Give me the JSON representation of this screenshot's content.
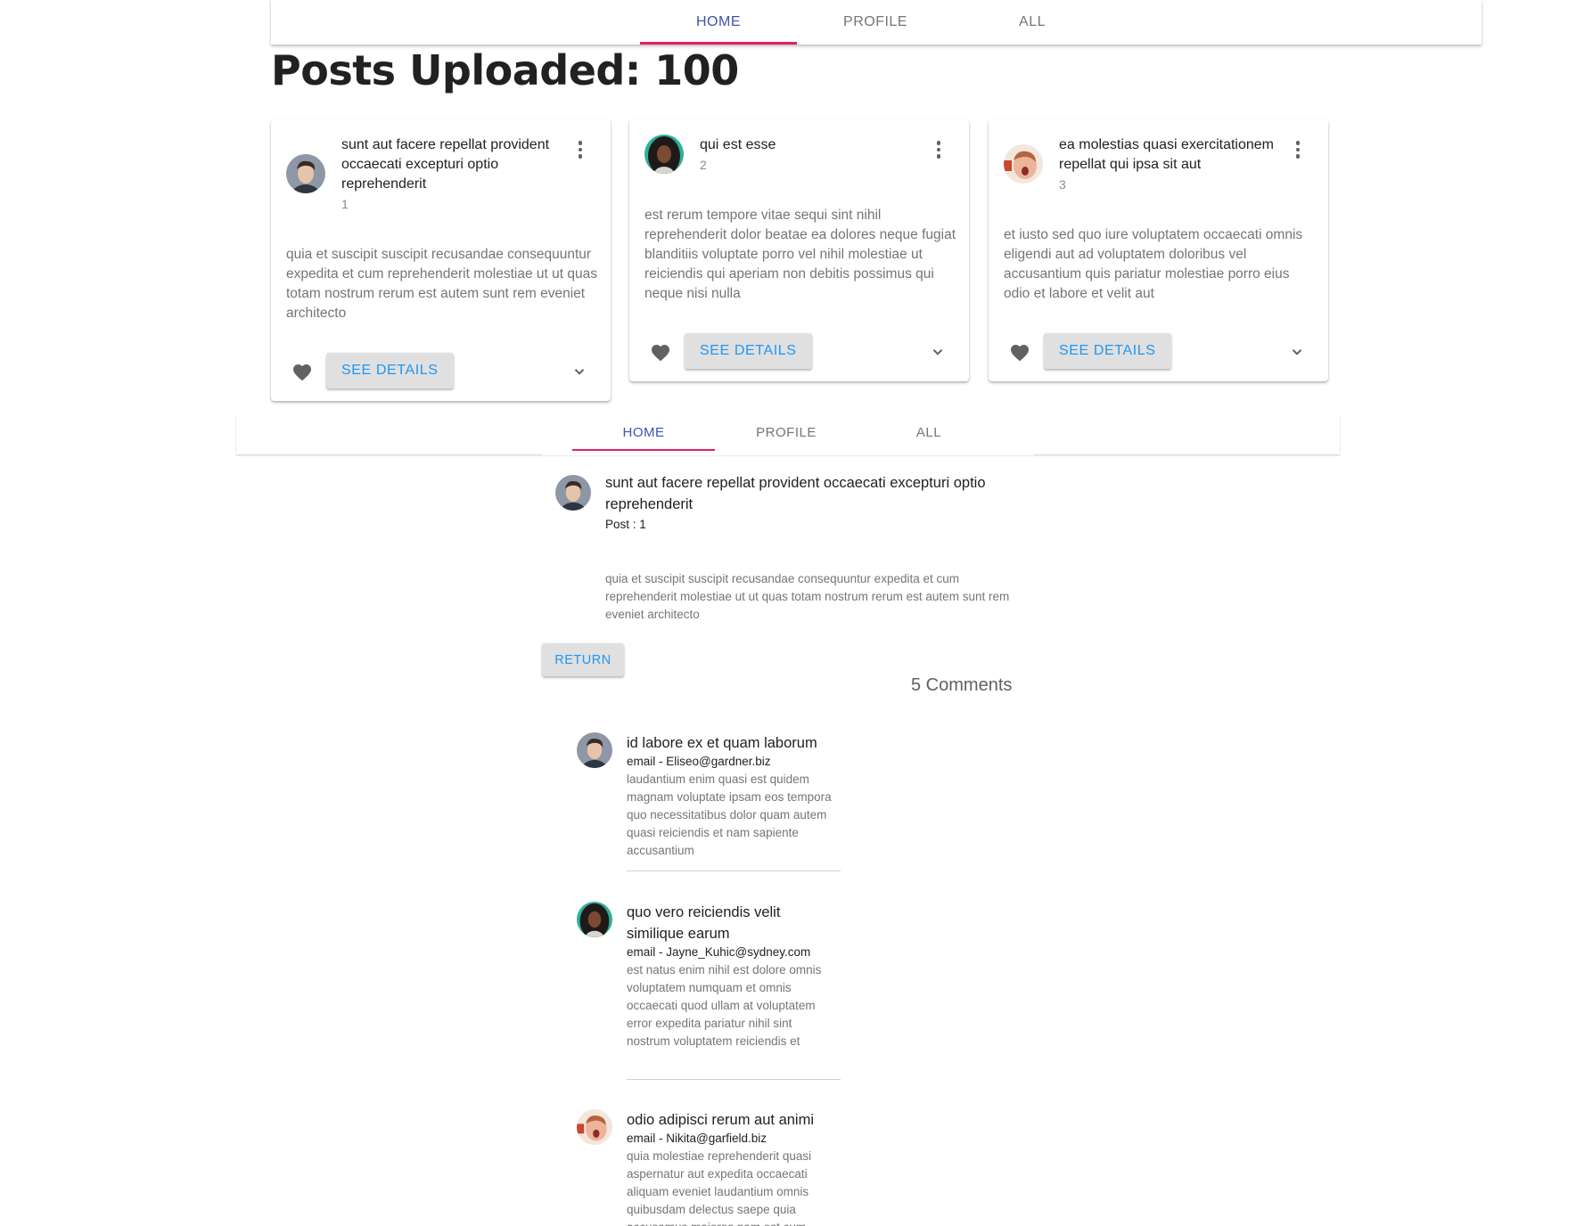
{
  "topnav": {
    "tabs": [
      "HOME",
      "PROFILE",
      "ALL"
    ],
    "active": "HOME"
  },
  "page_title": "Posts Uploaded: 100",
  "cards": [
    {
      "title": "sunt aut facere repellat provident occaecati excepturi optio reprehenderit",
      "id": "1",
      "body": "quia et suscipit suscipit recusandae consequuntur expedita et cum reprehenderit molestiae ut ut quas totam nostrum rerum est autem sunt rem eveniet architecto",
      "button": "SEE DETAILS"
    },
    {
      "title": "qui est esse",
      "id": "2",
      "body": "est rerum tempore vitae sequi sint nihil reprehenderit dolor beatae ea dolores neque fugiat blanditiis voluptate porro vel nihil molestiae ut reiciendis qui aperiam non debitis possimus qui neque nisi nulla",
      "button": "SEE DETAILS"
    },
    {
      "title": "ea molestias quasi exercitationem repellat qui ipsa sit aut",
      "id": "3",
      "body": "et iusto sed quo iure voluptatem occaecati omnis eligendi aut ad voluptatem doloribus vel accusantium quis pariatur molestiae porro eius odio et labore et velit aut",
      "button": "SEE DETAILS"
    }
  ],
  "subnav": {
    "tabs": [
      "HOME",
      "PROFILE",
      "ALL"
    ],
    "active": "HOME"
  },
  "detail": {
    "title": "sunt aut facere repellat provident occaecati excepturi optio reprehenderit",
    "subtitle": "Post : 1",
    "body": "quia et suscipit suscipit recusandae consequuntur expedita et cum reprehenderit molestiae ut ut quas totam nostrum rerum est autem sunt rem eveniet architecto",
    "return_label": "RETURN",
    "comments_count": "5 Comments"
  },
  "comments": [
    {
      "name": "id labore ex et quam laborum",
      "email": "email - Eliseo@gardner.biz",
      "body": "laudantium enim quasi est quidem magnam voluptate ipsam eos tempora quo necessitatibus dolor quam autem quasi reiciendis et nam sapiente accusantium"
    },
    {
      "name": "quo vero reiciendis velit similique earum",
      "email": "email - Jayne_Kuhic@sydney.com",
      "body": "est natus enim nihil est dolore omnis voluptatem numquam et omnis occaecati quod ullam at voluptatem error expedita pariatur nihil sint nostrum voluptatem reiciendis et"
    },
    {
      "name": "odio adipisci rerum aut animi",
      "email": "email - Nikita@garfield.biz",
      "body": "quia molestiae reprehenderit quasi aspernatur aut expedita occaecati aliquam eveniet laudantium omnis quibusdam delectus saepe quia accusamus maiores nam est cum"
    }
  ],
  "colors": {
    "primary": "#3f51b5",
    "indicator": "#e91e63",
    "button_text": "#2196f3",
    "button_bg": "#e0e0e0"
  },
  "icons": [
    "avatar-man-icon",
    "avatar-woman-icon",
    "avatar-surprised-icon",
    "more-vert-icon",
    "heart-icon",
    "chevron-down-icon"
  ]
}
